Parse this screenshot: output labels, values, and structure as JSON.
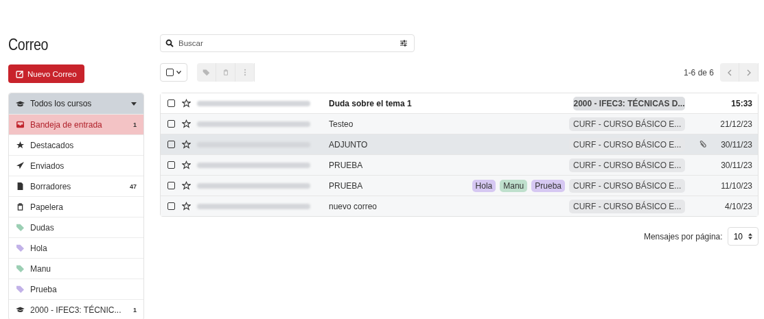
{
  "title": "Correo",
  "new_button": "Nuevo Correo",
  "sidebar": {
    "header": {
      "label": "Todos los cursos"
    },
    "items": [
      {
        "kind": "inbox",
        "label": "Bandeja de entrada",
        "count": "1",
        "selected": true
      },
      {
        "kind": "star",
        "label": "Destacados",
        "selected": false
      },
      {
        "kind": "sent",
        "label": "Enviados",
        "selected": false
      },
      {
        "kind": "draft",
        "label": "Borradores",
        "count": "47",
        "selected": false
      },
      {
        "kind": "trash",
        "label": "Papelera",
        "selected": false
      },
      {
        "kind": "tag",
        "label": "Dudas",
        "color": "#9ccfb4",
        "selected": false
      },
      {
        "kind": "tag",
        "label": "Hola",
        "color": "#c2b2e8",
        "selected": false
      },
      {
        "kind": "tag",
        "label": "Manu",
        "color": "#9ccfb4",
        "selected": false
      },
      {
        "kind": "tag",
        "label": "Prueba",
        "color": "#c2b2e8",
        "selected": false
      },
      {
        "kind": "course",
        "label": "2000 - IFEC3: TÉCNIC...",
        "count": "1",
        "selected": false
      }
    ]
  },
  "search": {
    "placeholder": "Buscar"
  },
  "pager": {
    "range": "1-6 de 6"
  },
  "messages": [
    {
      "sender_blurred": true,
      "subject": "Duda sobre el tema 1",
      "unread": true,
      "selected": false,
      "checked": false,
      "starred": false,
      "course": "2000 - IFEC3: TÉCNICAS D...",
      "attachment": false,
      "date": "15:33"
    },
    {
      "sender_blurred": true,
      "subject": "Testeo",
      "unread": false,
      "selected": false,
      "checked": false,
      "starred": false,
      "course": "CURF - CURSO BÁSICO E...",
      "attachment": false,
      "date": "21/12/23"
    },
    {
      "sender_blurred": true,
      "subject": "ADJUNTO",
      "unread": false,
      "selected": true,
      "checked": false,
      "starred": false,
      "course": "CURF - CURSO BÁSICO E...",
      "attachment": true,
      "date": "30/11/23"
    },
    {
      "sender_blurred": true,
      "subject": "PRUEBA",
      "unread": false,
      "selected": false,
      "checked": false,
      "starred": false,
      "course": "CURF - CURSO BÁSICO E...",
      "attachment": false,
      "date": "30/11/23"
    },
    {
      "sender_blurred": true,
      "subject": "PRUEBA",
      "unread": false,
      "selected": false,
      "checked": false,
      "starred": false,
      "tags": [
        {
          "label": "Hola",
          "color": "#d6c8f2"
        },
        {
          "label": "Manu",
          "color": "#bfe0cd"
        },
        {
          "label": "Prueba",
          "color": "#d6c8f2"
        }
      ],
      "course": "CURF - CURSO BÁSICO E...",
      "attachment": false,
      "date": "11/10/23"
    },
    {
      "sender_blurred": true,
      "subject": "nuevo correo",
      "unread": false,
      "selected": false,
      "checked": false,
      "starred": false,
      "course": "CURF - CURSO BÁSICO E...",
      "attachment": false,
      "date": "4/10/23"
    }
  ],
  "per_page": {
    "label": "Mensajes por página:",
    "value": "10"
  }
}
